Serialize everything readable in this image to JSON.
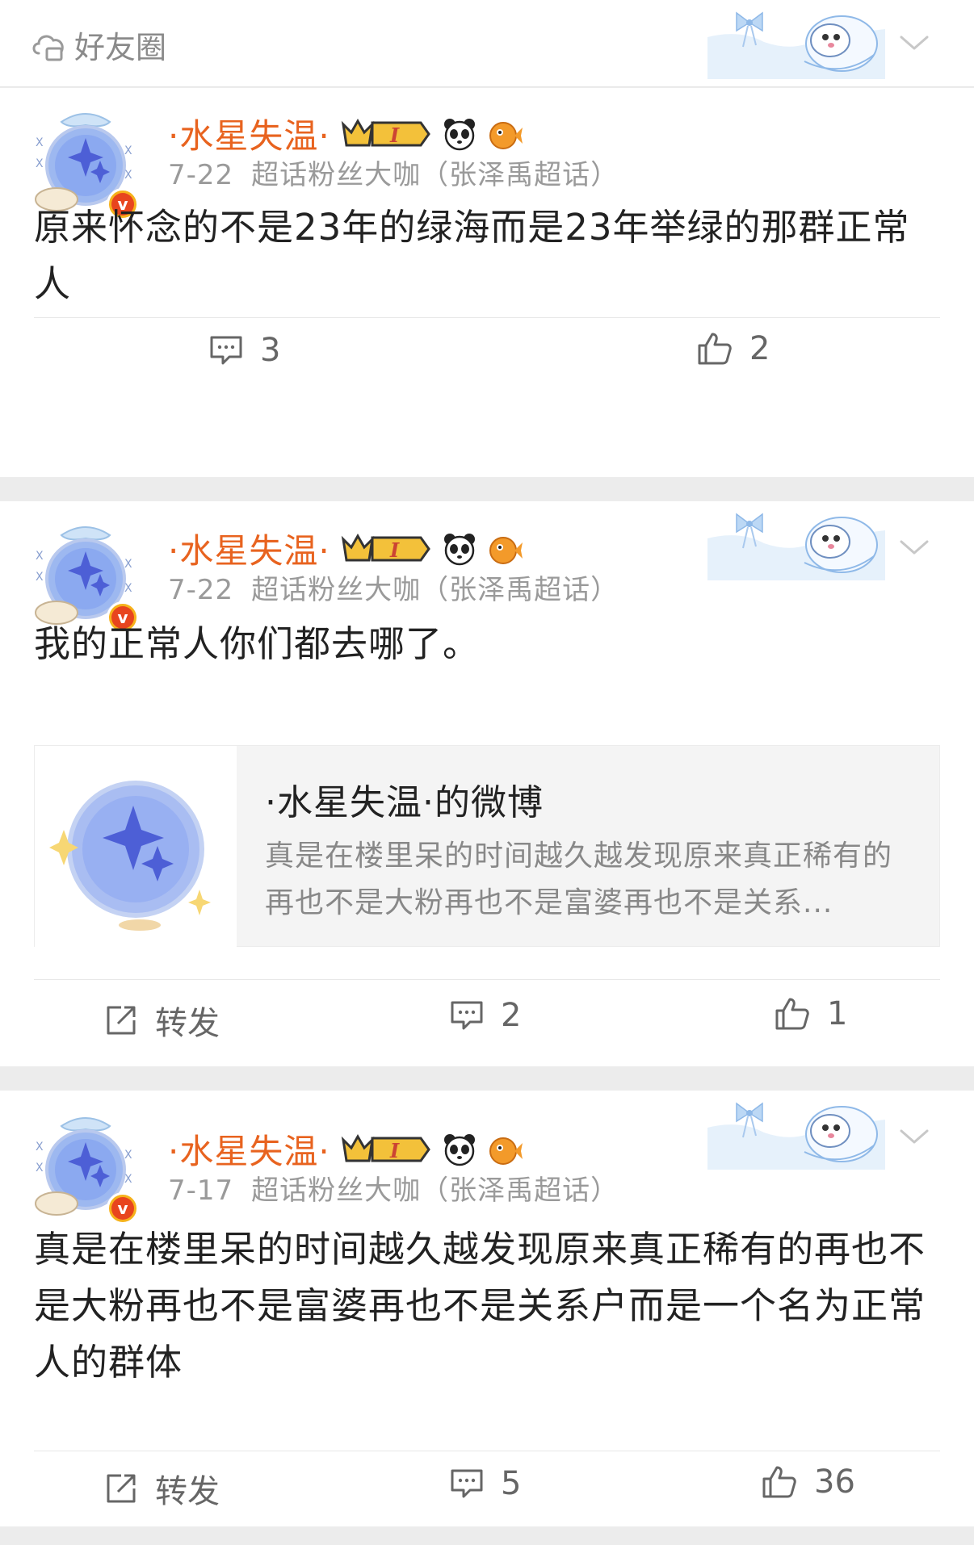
{
  "header": {
    "visibility_label": "好友圈"
  },
  "posts": [
    {
      "username": "·水星失温·",
      "date": "7-22",
      "source": "超话粉丝大咖（张泽禹超话）",
      "text": "原来怀念的不是23年的绿海而是23年举绿的那群正常人",
      "actions": {
        "comment_count": "3",
        "like_count": "2"
      }
    },
    {
      "username": "·水星失温·",
      "date": "7-22",
      "source": "超话粉丝大咖（张泽禹超话）",
      "text": "我的正常人你们都去哪了。",
      "quote": {
        "title": "·水星失温·的微博",
        "excerpt": "真是在楼里呆的时间越久越发现原来真正稀有的再也不是大粉再也不是富婆再也不是关系..."
      },
      "actions": {
        "repost_label": "转发",
        "comment_count": "2",
        "like_count": "1"
      }
    },
    {
      "username": "·水星失温·",
      "date": "7-17",
      "source": "超话粉丝大咖（张泽禹超话）",
      "text": "真是在楼里呆的时间越久越发现原来真正稀有的再也不是大粉再也不是富婆再也不是关系户而是一个名为正常人的群体",
      "actions": {
        "repost_label": "转发",
        "comment_count": "5",
        "like_count": "36"
      }
    }
  ],
  "badges": {
    "level_badge_text": "I"
  },
  "colors": {
    "username": "#e8631f",
    "meta": "#9a9a9a",
    "icon": "#666666"
  }
}
